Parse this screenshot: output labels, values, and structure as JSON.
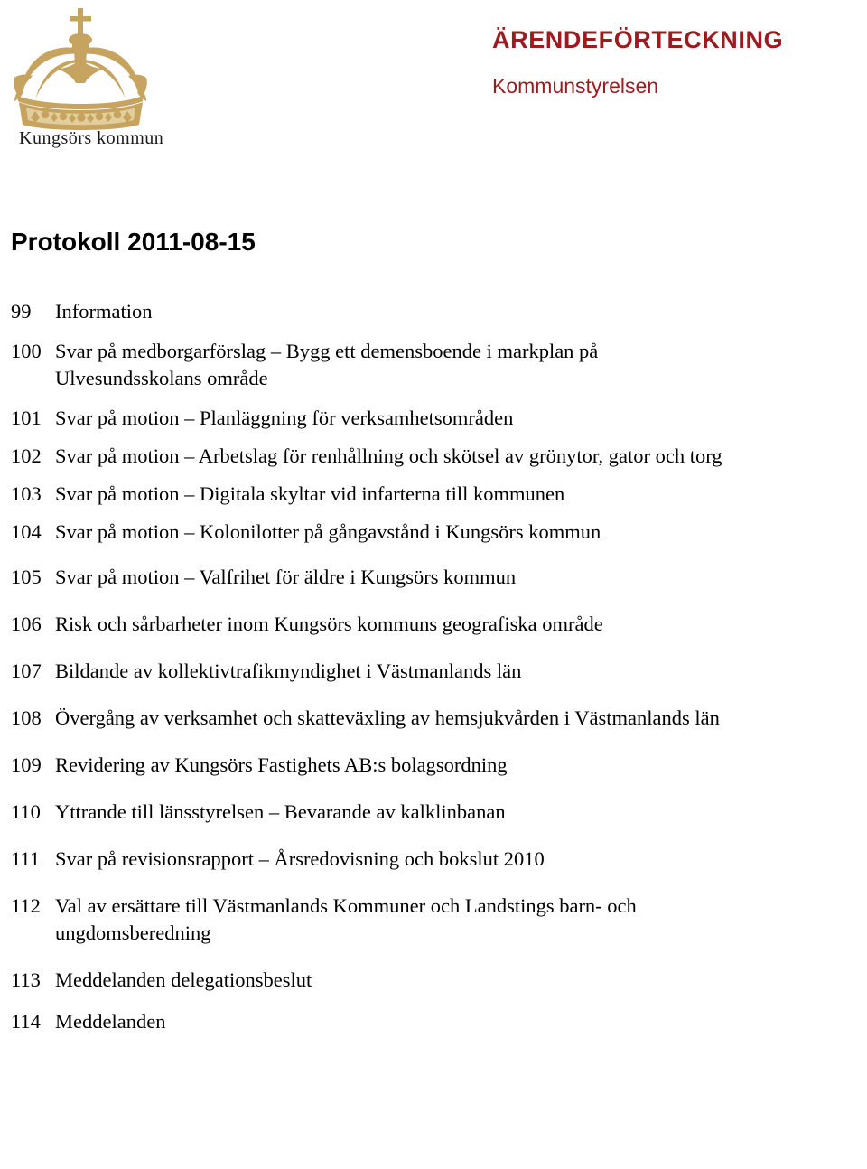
{
  "logo": {
    "wordmark": "Kungsörs kommun",
    "icon": "crown-icon",
    "color": "#c6a35e"
  },
  "header": {
    "kicker": "ÄRENDEFÖRTECKNING",
    "body": "Kommunstyrelsen",
    "color": "#9b1b1e"
  },
  "title": "Protokoll 2011-08-15",
  "agenda": [
    {
      "num": "99",
      "text": "Information",
      "sub": ""
    },
    {
      "num": "100",
      "text": "Svar på medborgarförslag – Bygg ett demensboende i markplan på",
      "sub": "Ulvesundsskolans område"
    },
    {
      "num": "101",
      "text": "Svar på motion – Planläggning för verksamhetsområden",
      "sub": ""
    },
    {
      "num": "102",
      "text": "Svar på motion – Arbetslag för renhållning och skötsel av grönytor, gator och torg",
      "sub": ""
    },
    {
      "num": "103",
      "text": "Svar på motion – Digitala skyltar vid infarterna till kommunen",
      "sub": ""
    },
    {
      "num": "104",
      "text": "Svar på motion – Kolonilotter på gångavstånd i Kungsörs kommun",
      "sub": ""
    },
    {
      "num": "105",
      "text": "Svar på motion – Valfrihet för äldre i Kungsörs kommun",
      "sub": ""
    },
    {
      "num": "106",
      "text": "Risk och sårbarheter inom Kungsörs kommuns geografiska område",
      "sub": ""
    },
    {
      "num": "107",
      "text": "Bildande av kollektivtrafikmyndighet i Västmanlands län",
      "sub": ""
    },
    {
      "num": "108",
      "text": "Övergång av verksamhet och skatteväxling av hemsjukvården i Västmanlands län",
      "sub": ""
    },
    {
      "num": "109",
      "text": "Revidering av Kungsörs Fastighets AB:s bolagsordning",
      "sub": ""
    },
    {
      "num": "110",
      "text": "Yttrande till länsstyrelsen – Bevarande av kalklinbanan",
      "sub": ""
    },
    {
      "num": "111",
      "text": "Svar på revisionsrapport – Årsredovisning och bokslut 2010",
      "sub": ""
    },
    {
      "num": "112",
      "text": "Val av ersättare till Västmanlands Kommuner och Landstings barn- och",
      "sub": "ungdomsberedning"
    },
    {
      "num": "113",
      "text": "Meddelanden delegationsbeslut",
      "sub": ""
    },
    {
      "num": "114",
      "text": "Meddelanden",
      "sub": ""
    }
  ],
  "agenda_spacing": [
    0,
    14,
    14,
    12,
    12,
    12,
    20,
    22,
    22,
    22,
    22,
    22,
    22,
    22,
    22,
    16
  ]
}
